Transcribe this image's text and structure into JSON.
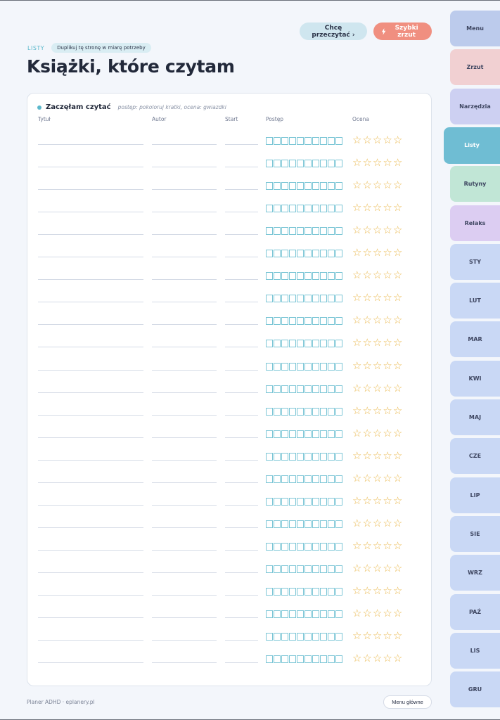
{
  "header": {
    "breadcrumb": "LISTY",
    "duplicate_badge": "Duplikuj tę stronę w miarę potrzeby",
    "title": "Książki, które czytam",
    "want_to_read_button": "Chcę przeczytać ›",
    "quick_dump_button": "Szybki zrzut"
  },
  "card": {
    "title": "Zaczęłam czytać",
    "hint": "postęp: pokoloruj kratki, ocena: gwiazdki",
    "columns": {
      "title": "Tytuł",
      "author": "Autor",
      "start": "Start",
      "progress": "Postęp",
      "rating": "Ocena"
    },
    "row_count": 24,
    "progress_boxes": 10,
    "stars": 5,
    "star_glyph": "☆"
  },
  "footer": {
    "brand": "Planer ADHD · eplanery.pl",
    "menu_button": "Menu główne"
  },
  "tabs": [
    {
      "label": "Menu",
      "color": "#bccbec"
    },
    {
      "label": "Zrzut",
      "color": "#f1d0d2"
    },
    {
      "label": "Narzędzia",
      "color": "#cdd0f2"
    },
    {
      "label": "Listy",
      "color": "#6fbdd3",
      "active": true
    },
    {
      "label": "Rutyny",
      "color": "#c1e6d6"
    },
    {
      "label": "Relaks",
      "color": "#dccdf2"
    },
    {
      "label": "STY",
      "color": "#c9d8f5"
    },
    {
      "label": "LUT",
      "color": "#c9d8f5"
    },
    {
      "label": "MAR",
      "color": "#c9d8f5"
    },
    {
      "label": "KWI",
      "color": "#c9d8f5"
    },
    {
      "label": "MAJ",
      "color": "#c9d8f5"
    },
    {
      "label": "CZE",
      "color": "#c9d8f5"
    },
    {
      "label": "LIP",
      "color": "#c9d8f5"
    },
    {
      "label": "SIE",
      "color": "#c9d8f5"
    },
    {
      "label": "WRZ",
      "color": "#c9d8f5"
    },
    {
      "label": "PAŹ",
      "color": "#c9d8f5"
    },
    {
      "label": "LIS",
      "color": "#c9d8f5"
    },
    {
      "label": "GRU",
      "color": "#c9d8f5"
    }
  ]
}
